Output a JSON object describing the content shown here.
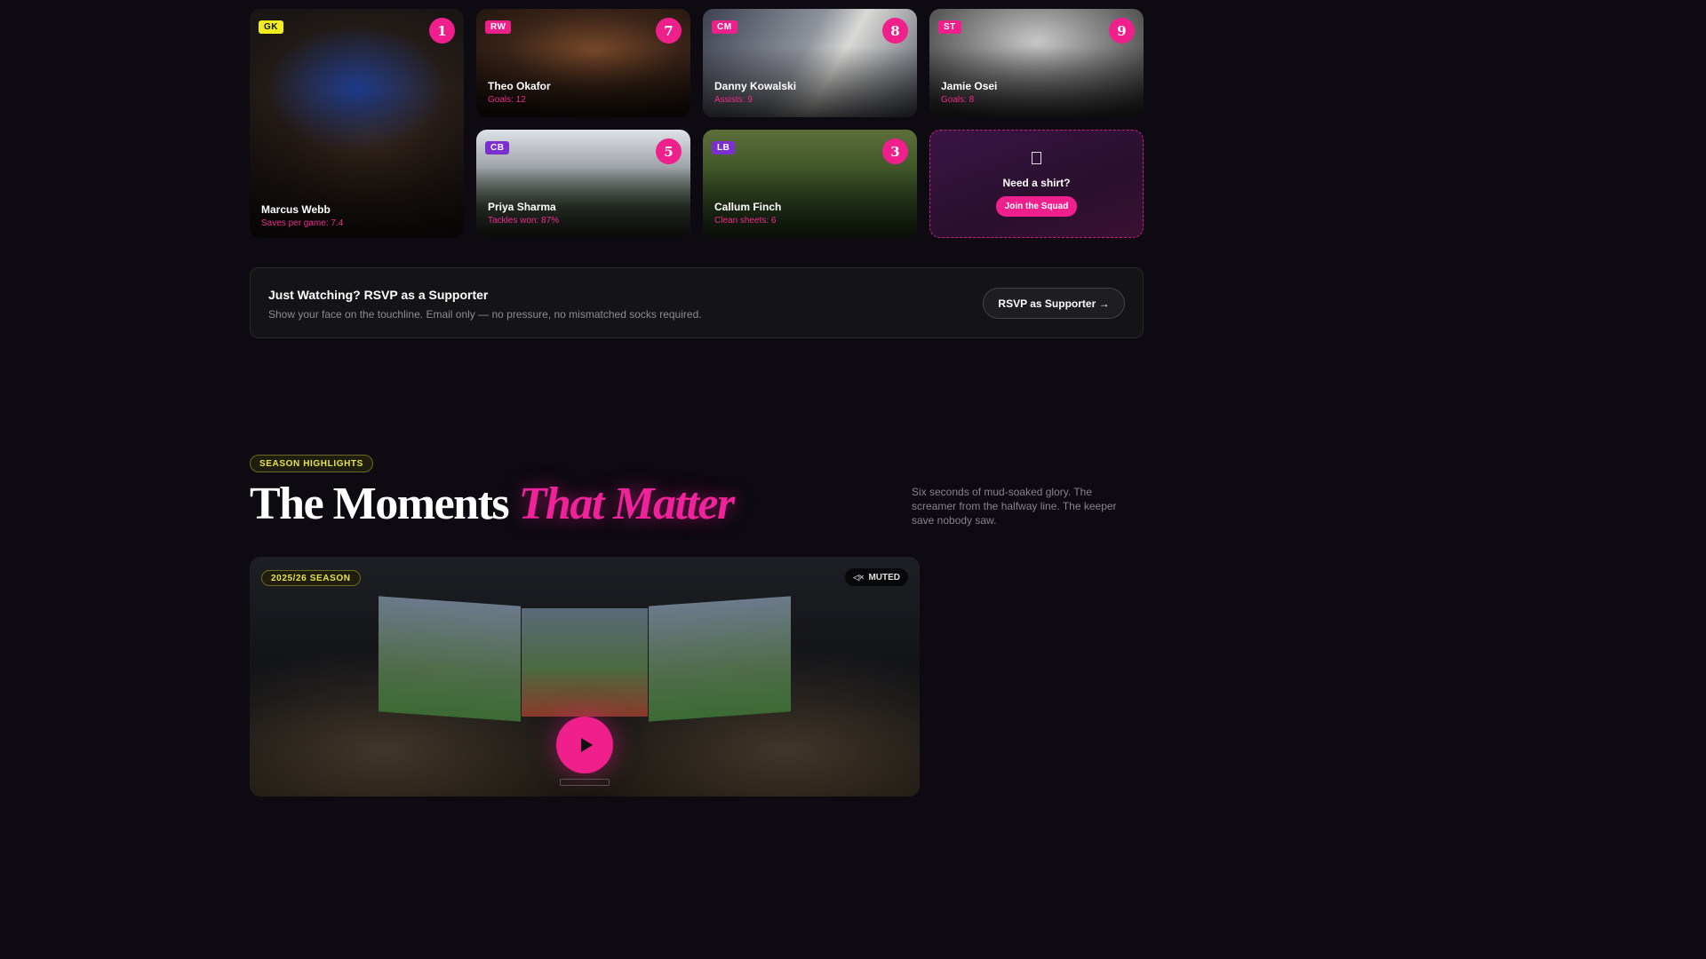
{
  "squad": {
    "players": [
      {
        "position": "GK",
        "number": "1",
        "name": "Marcus Webb",
        "stat": "Saves per game: 7.4",
        "badge_color": "#f2ee1c",
        "badge_text_color": "#111111"
      },
      {
        "position": "RW",
        "number": "7",
        "name": "Theo Okafor",
        "stat": "Goals: 12",
        "badge_color": "#ef1f8c",
        "badge_text_color": "#ffffff"
      },
      {
        "position": "CM",
        "number": "8",
        "name": "Danny Kowalski",
        "stat": "Assists: 9",
        "badge_color": "#ef1f8c",
        "badge_text_color": "#ffffff"
      },
      {
        "position": "ST",
        "number": "9",
        "name": "Jamie Osei",
        "stat": "Goals: 8",
        "badge_color": "#ef1f8c",
        "badge_text_color": "#ffffff"
      },
      {
        "position": "CB",
        "number": "5",
        "name": "Priya Sharma",
        "stat": "Tackles won: 87%",
        "badge_color": "#7b2fd0",
        "badge_text_color": "#ffffff"
      },
      {
        "position": "LB",
        "number": "3",
        "name": "Callum Finch",
        "stat": "Clean sheets: 6",
        "badge_color": "#7b2fd0",
        "badge_text_color": "#ffffff"
      }
    ],
    "join_card": {
      "icon": "shirt-icon",
      "title": "Need a shirt?",
      "button_label": "Join the Squad"
    }
  },
  "rsvp": {
    "title": "Just Watching? RSVP as a Supporter",
    "subtitle": "Show your face on the touchline. Email only — no pressure, no mismatched socks required.",
    "button_label": "RSVP as Supporter →"
  },
  "highlights": {
    "tag": "SEASON HIGHLIGHTS",
    "heading_main": "The Moments",
    "heading_accent": "That Matter",
    "description": "Six seconds of mud-soaked glory. The screamer from the halfway line. The keeper save nobody saw.",
    "video": {
      "season_badge": "2025/26 SEASON",
      "muted_label": "MUTED",
      "play_icon": "play-icon"
    }
  },
  "colors": {
    "accent_pink": "#ef1f8c",
    "accent_yellow": "#e7e34a",
    "background": "#0d0a11"
  }
}
